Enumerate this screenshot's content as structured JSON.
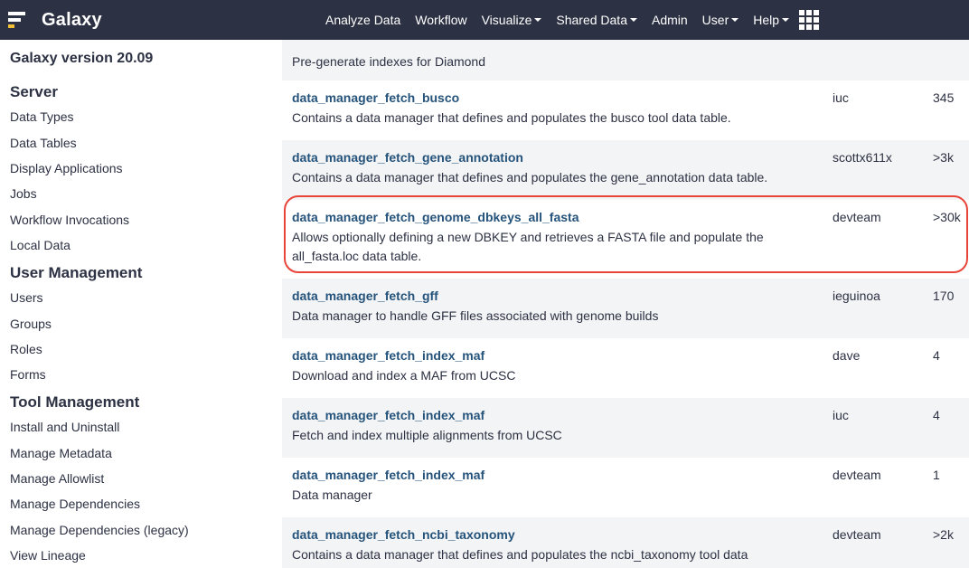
{
  "masthead": {
    "brand": "Galaxy",
    "nav": [
      {
        "label": "Analyze Data",
        "dropdown": false
      },
      {
        "label": "Workflow",
        "dropdown": false
      },
      {
        "label": "Visualize",
        "dropdown": true
      },
      {
        "label": "Shared Data",
        "dropdown": true
      },
      {
        "label": "Admin",
        "dropdown": false
      },
      {
        "label": "User",
        "dropdown": true
      },
      {
        "label": "Help",
        "dropdown": true
      }
    ]
  },
  "sidebar": {
    "version": "Galaxy version 20.09",
    "server_heading": "Server",
    "server_items": [
      "Data Types",
      "Data Tables",
      "Display Applications",
      "Jobs",
      "Workflow Invocations",
      "Local Data"
    ],
    "user_heading": "User Management",
    "user_items": [
      "Users",
      "Groups",
      "Roles",
      "Forms"
    ],
    "tool_heading": "Tool Management",
    "tool_items": [
      "Install and Uninstall",
      "Manage Metadata",
      "Manage Allowlist",
      "Manage Dependencies",
      "Manage Dependencies (legacy)",
      "View Lineage"
    ]
  },
  "table": {
    "rows": [
      {
        "name": "",
        "description": "Pre-generate indexes for Diamond",
        "owner": "",
        "count": ""
      },
      {
        "name": "data_manager_fetch_busco",
        "description": "Contains a data manager that defines and populates the busco tool data table.",
        "owner": "iuc",
        "count": "345"
      },
      {
        "name": "data_manager_fetch_gene_annotation",
        "description": "Contains a data manager that defines and populates the gene_annotation data table.",
        "owner": "scottx611x",
        "count": ">3k"
      },
      {
        "name": "data_manager_fetch_genome_dbkeys_all_fasta",
        "description": "Allows optionally defining a new DBKEY and retrieves a FASTA file and populate the all_fasta.loc data table.",
        "owner": "devteam",
        "count": ">30k"
      },
      {
        "name": "data_manager_fetch_gff",
        "description": "Data manager to handle GFF files associated with genome builds",
        "owner": "ieguinoa",
        "count": "170"
      },
      {
        "name": "data_manager_fetch_index_maf",
        "description": "Download and index a MAF from UCSC",
        "owner": "dave",
        "count": "4"
      },
      {
        "name": "data_manager_fetch_index_maf",
        "description": "Fetch and index multiple alignments from UCSC",
        "owner": "iuc",
        "count": "4"
      },
      {
        "name": "data_manager_fetch_index_maf",
        "description": "Data manager",
        "owner": "devteam",
        "count": "1"
      },
      {
        "name": "data_manager_fetch_ncbi_taxonomy",
        "description": "Contains a data manager that defines and populates the ncbi_taxonomy tool data table.",
        "owner": "devteam",
        "count": ">2k"
      }
    ],
    "highlighted_row_name": "data_manager_fetch_genome_dbkeys_all_fasta"
  },
  "colors": {
    "masthead": "#2c3143",
    "link": "#25537b",
    "row_stripe": "#f3f4f5",
    "highlight": "#e8443a",
    "logo_accent": "#f2c037"
  }
}
